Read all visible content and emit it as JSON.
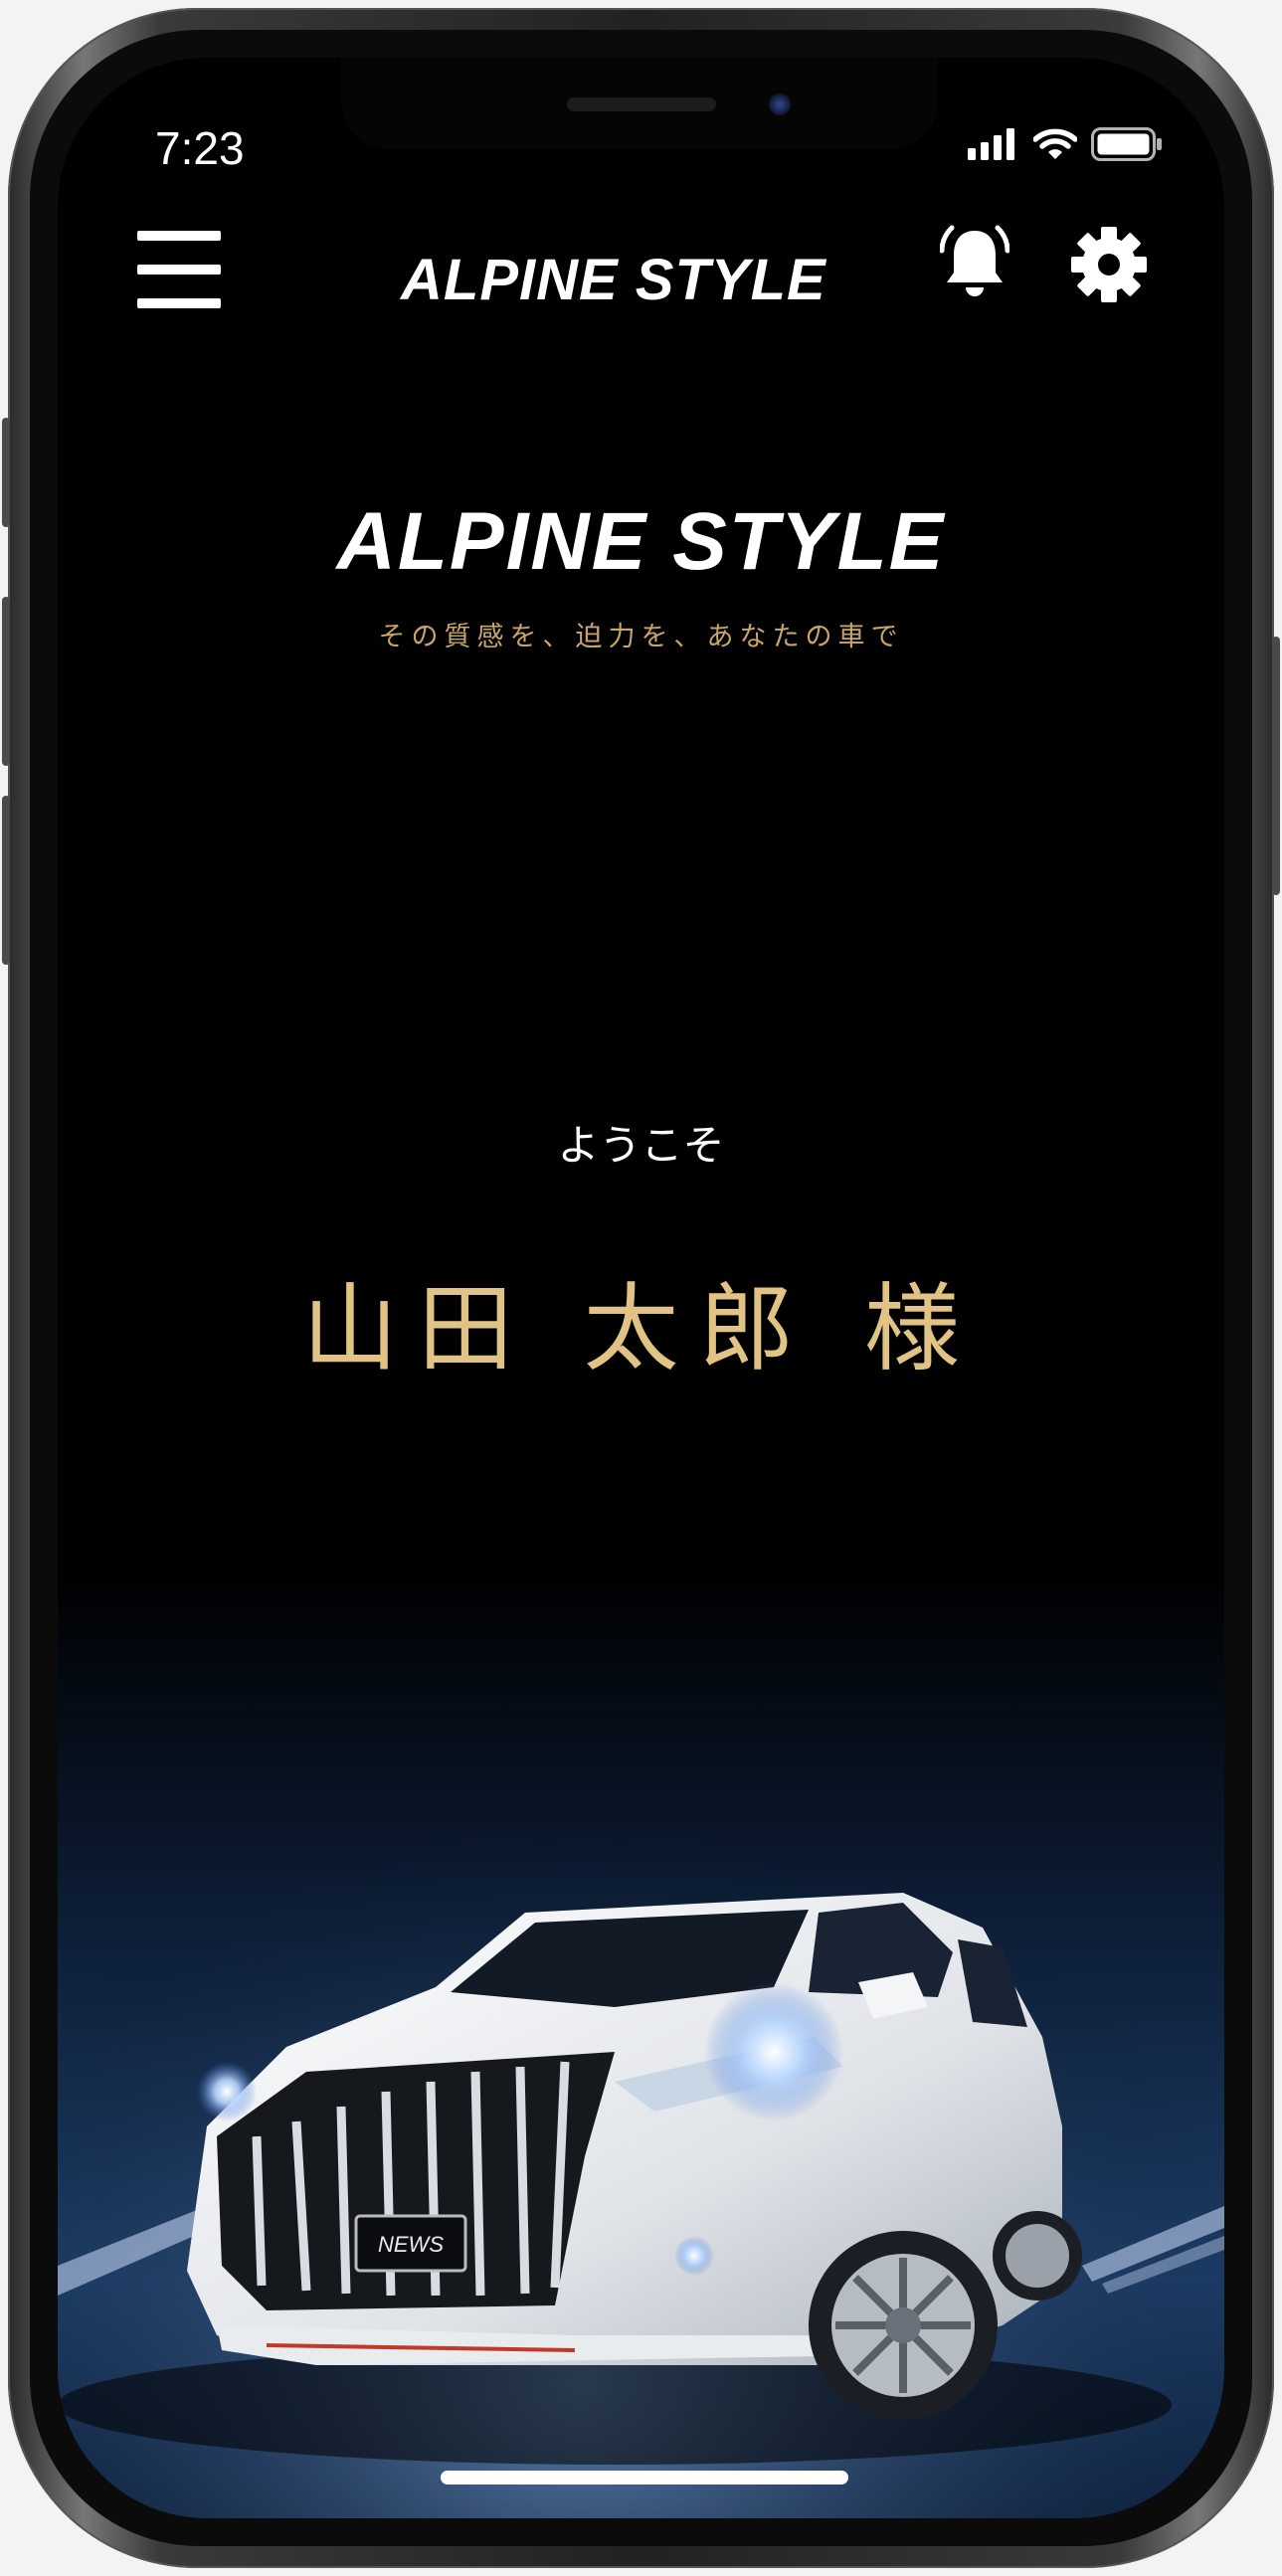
{
  "status_bar": {
    "time": "7:23",
    "icons": [
      "cellular-signal-icon",
      "wifi-icon",
      "battery-icon"
    ]
  },
  "header": {
    "menu_icon": "hamburger-menu-icon",
    "logo_text": "ALPINE STYLE",
    "notification_icon": "bell-icon",
    "settings_icon": "gear-icon"
  },
  "hero": {
    "logo_text": "ALPINE STYLE",
    "tagline": "その質感を、迫力を、あなたの車で"
  },
  "welcome": {
    "greeting": "ようこそ",
    "user_name": "山田 太郎 様"
  },
  "vehicle": {
    "badge_text": "NEWS"
  },
  "colors": {
    "background": "#000000",
    "accent_gold": "#e2c386",
    "tagline_gold": "#c9a56b",
    "text": "#ffffff"
  }
}
